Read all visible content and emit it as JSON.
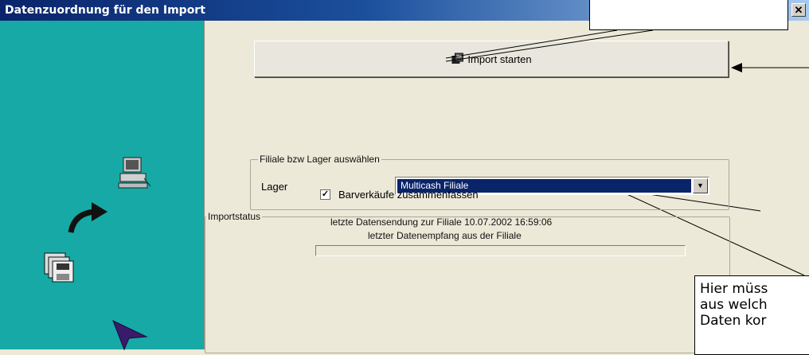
{
  "window": {
    "title": "Datenzuordnung für den Import",
    "close_label": "✕"
  },
  "import_button": {
    "label": "Import starten"
  },
  "branch_group": {
    "legend": "Filiale bzw Lager auswählen"
  },
  "lager": {
    "label": "Lager",
    "selected": "Multicash Filiale"
  },
  "checkbox": {
    "label": "Barverkäufe zusammenfassen",
    "checked": true
  },
  "status": {
    "legend": "Importstatus",
    "line1": "letzte Datensendung zur Filiale 10.07.2002 16:59:06",
    "line2": "letzter Datenempfang aus der Filiale"
  },
  "callout_right": {
    "lines": [
      "Hier müss",
      "aus welch",
      "Daten kor"
    ]
  }
}
